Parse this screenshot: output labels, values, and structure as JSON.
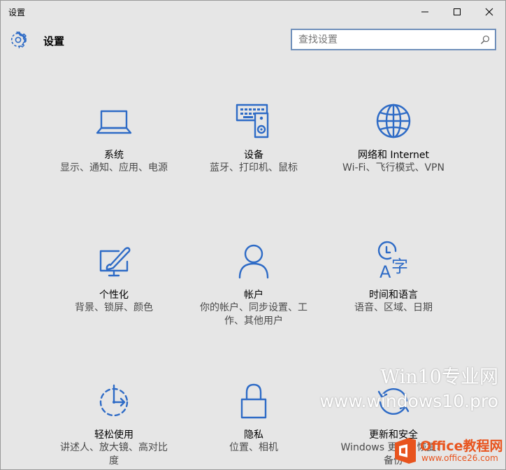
{
  "window": {
    "title": "设置",
    "minimize_glyph": "minimize-icon",
    "maximize_glyph": "maximize-icon",
    "close_glyph": "close-icon"
  },
  "header": {
    "title": "设置",
    "icon": "gear-icon"
  },
  "search": {
    "placeholder": "查找设置",
    "value": "",
    "icon": "search-icon"
  },
  "accent_color": "#2e6bc6",
  "tiles": [
    {
      "id": "system",
      "icon": "laptop-icon",
      "name": "系统",
      "desc": "显示、通知、应用、电源"
    },
    {
      "id": "devices",
      "icon": "devices-icon",
      "name": "设备",
      "desc": "蓝牙、打印机、鼠标"
    },
    {
      "id": "network",
      "icon": "globe-icon",
      "name": "网络和 Internet",
      "desc": "Wi-Fi、飞行模式、VPN"
    },
    {
      "id": "personalization",
      "icon": "personalization-icon",
      "name": "个性化",
      "desc": "背景、锁屏、颜色"
    },
    {
      "id": "accounts",
      "icon": "person-icon",
      "name": "帐户",
      "desc": "你的帐户、同步设置、工作、其他用户"
    },
    {
      "id": "time_language",
      "icon": "time-language-icon",
      "name": "时间和语言",
      "desc": "语音、区域、日期"
    },
    {
      "id": "ease_of_access",
      "icon": "ease-of-access-icon",
      "name": "轻松使用",
      "desc": "讲述人、放大镜、高对比度"
    },
    {
      "id": "privacy",
      "icon": "lock-icon",
      "name": "隐私",
      "desc": "位置、相机"
    },
    {
      "id": "update_security",
      "icon": "update-icon",
      "name": "更新和安全",
      "desc": "Windows 更新、恢复、备份"
    }
  ],
  "watermark": {
    "line1": "Win10专业网",
    "line2": "www.windows10.pro"
  },
  "badge": {
    "brand": "Office教程网",
    "url": "www.office26.com"
  }
}
